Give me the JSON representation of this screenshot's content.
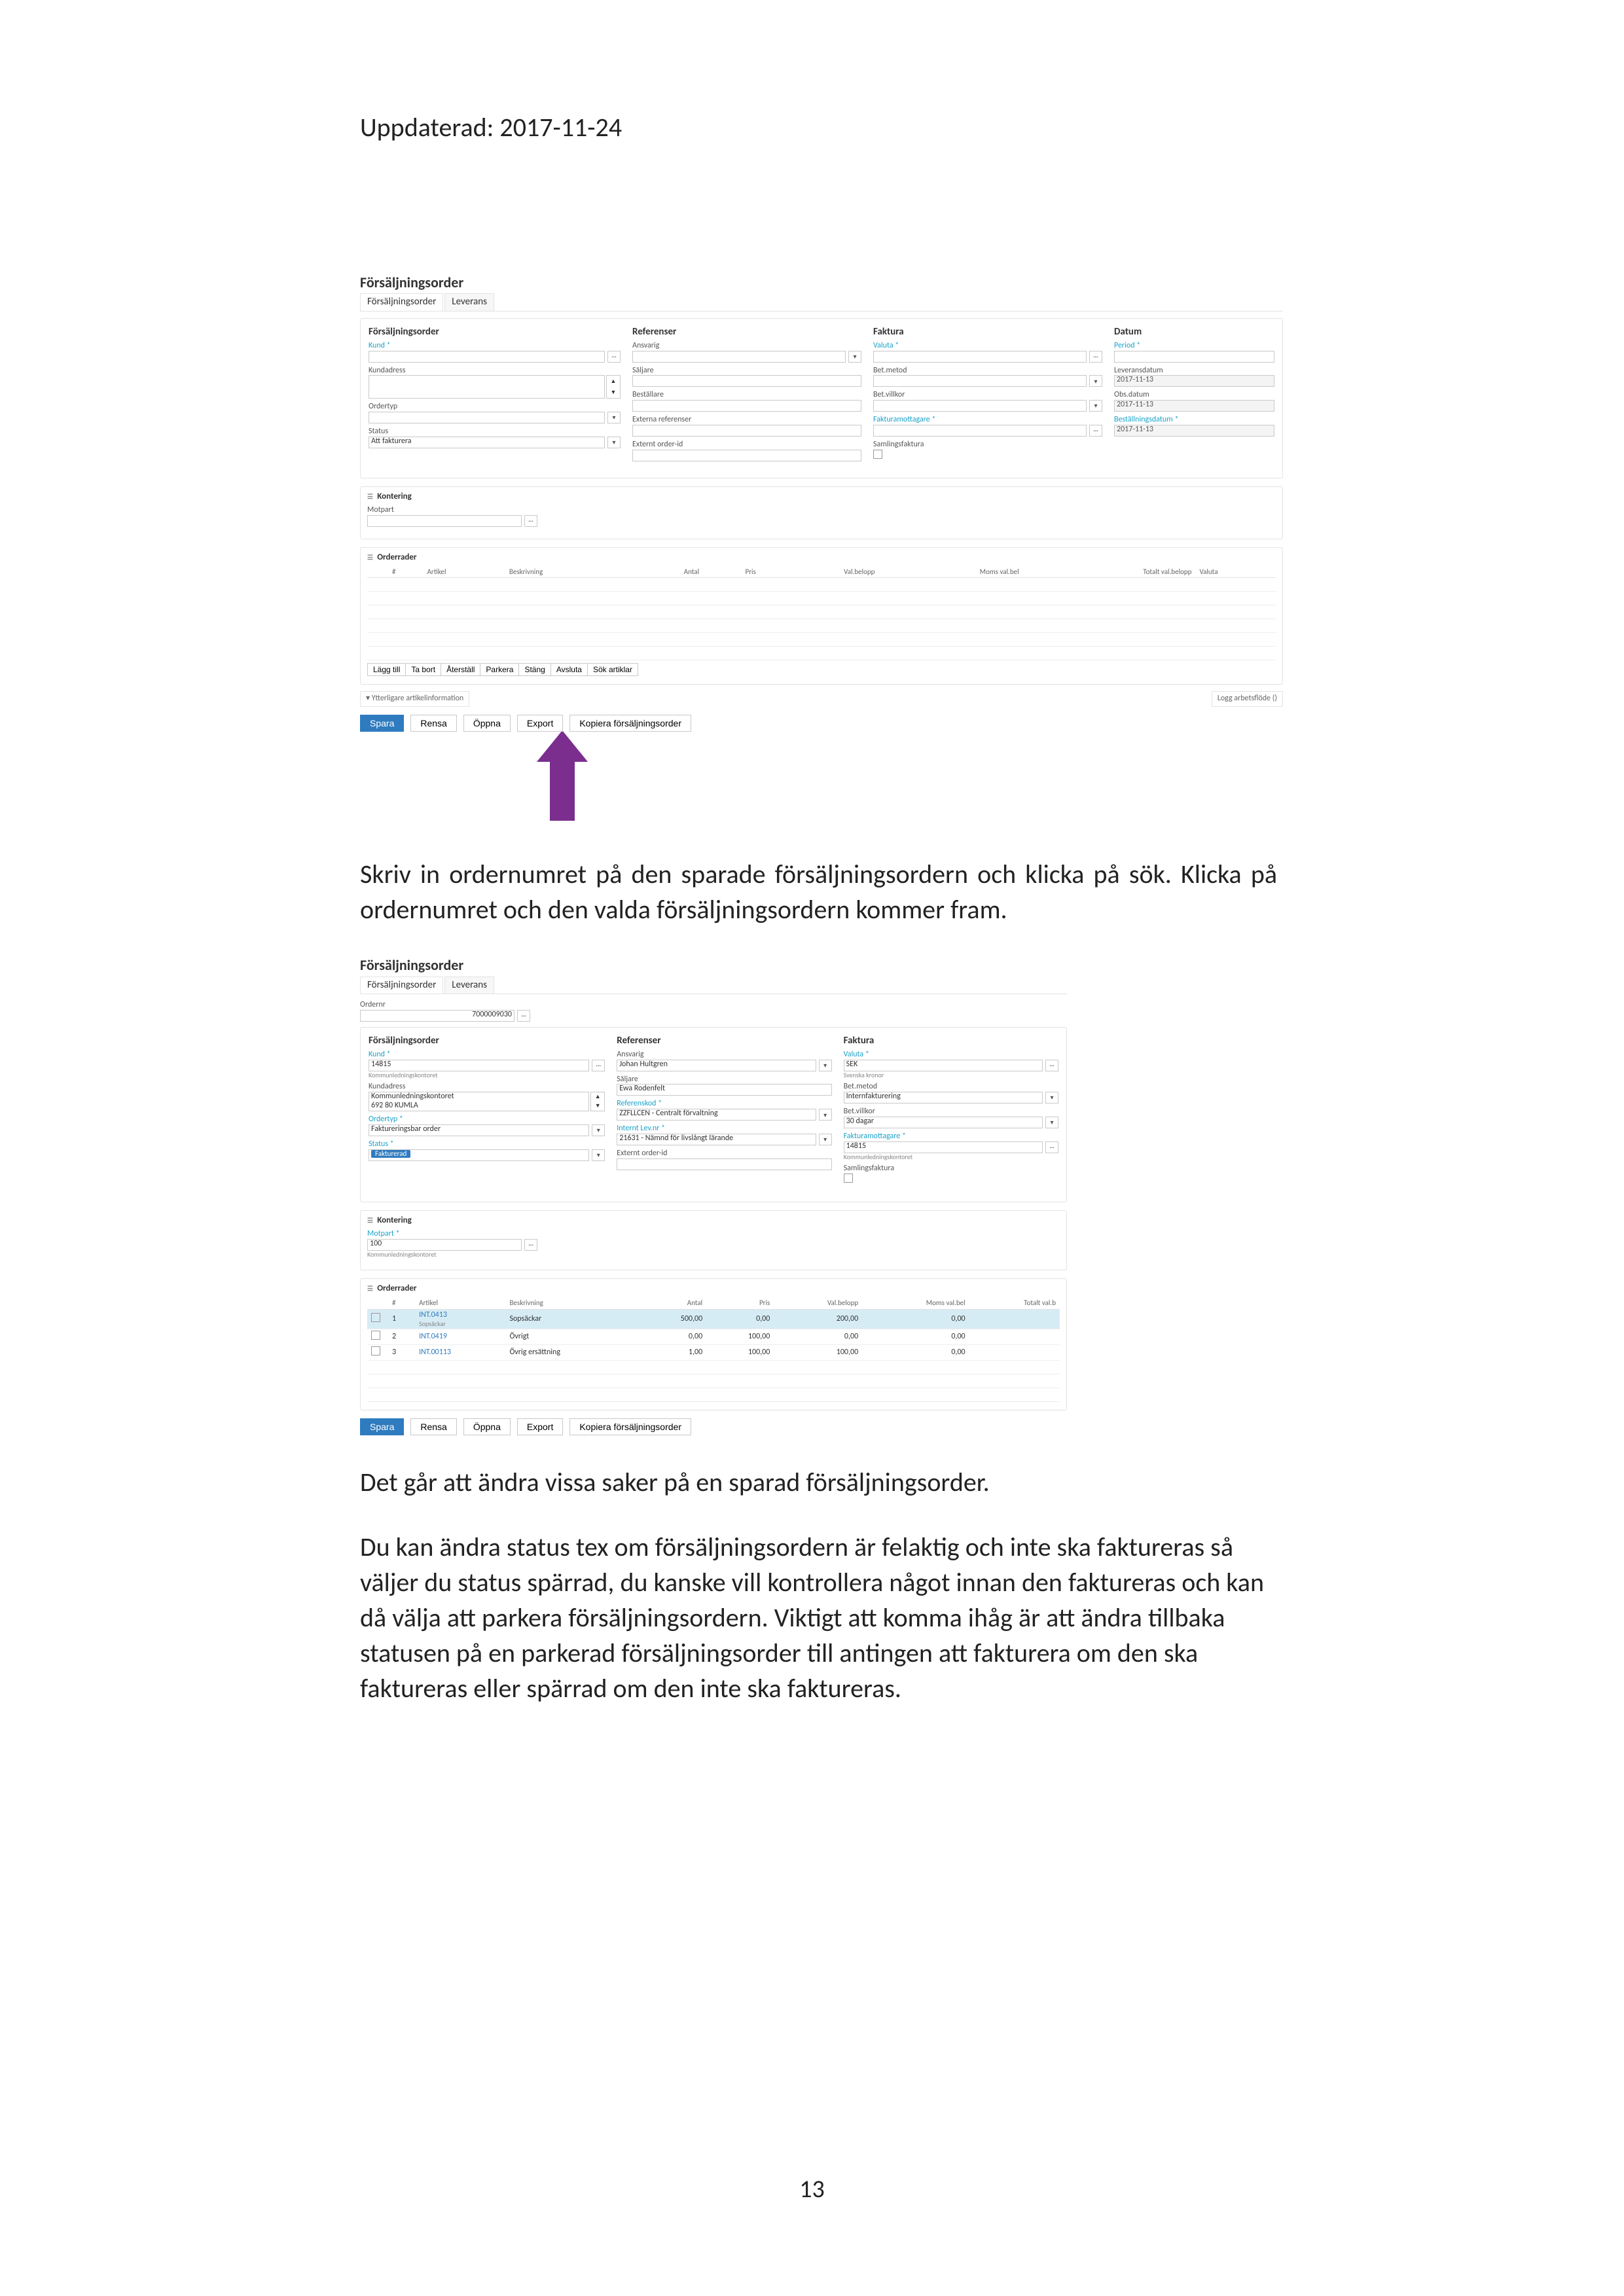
{
  "doc": {
    "header": "Uppdaterad: 2017-11-24",
    "p1": "Skriv in ordernumret på den sparade försäljningsordern och klicka på sök. Klicka på ordernumret och den valda försäljningsordern kommer fram.",
    "p2": "Det går att ändra vissa saker på en sparad försäljningsorder.",
    "p3": "Du kan ändra status tex om försäljningsordern är felaktig och inte ska faktureras så väljer du status spärrad, du kanske vill kontrollera något innan den faktureras och kan då välja att parkera försäljningsordern. Viktigt att komma ihåg är att ändra tillbaka statusen på en parkerad försäljningsorder till antingen att fakturera om den ska faktureras eller spärrad om den inte ska faktureras.",
    "page_number": "13"
  },
  "common": {
    "window_title": "Försäljningsorder",
    "tabs": {
      "a": "Försäljningsorder",
      "b": "Leverans"
    },
    "panels": {
      "a": "Försäljningsorder",
      "b": "Referenser",
      "c": "Faktura",
      "d": "Datum"
    },
    "labels": {
      "kund": "Kund *",
      "kundadress": "Kundadress",
      "ordertyp": "Ordertyp",
      "status": "Status",
      "ansvarig": "Ansvarig",
      "saljare": "Säljare",
      "bestallare": "Beställare",
      "externa_ref": "Externa referenser",
      "externt_oid": "Externt order-id",
      "valuta": "Valuta *",
      "betmetod": "Bet.metod",
      "betvillkor": "Bet.villkor",
      "fakturamott": "Fakturamottagare *",
      "samlfakt": "Samlingsfaktura",
      "period": "Period *",
      "leveransdatum": "Leveransdatum",
      "obsdatum": "Obs.datum",
      "bestallningsdatum": "Beställningsdatum *",
      "motpart": "Motpart",
      "ordernr": "Ordernr",
      "referenskod": "Referenskod *",
      "internt_lev": "Internt Lev.nr *",
      "ordertyp_req": "Ordertyp *",
      "status_req": "Status *",
      "motpart_req": "Motpart *"
    },
    "sections": {
      "kontering": "Kontering",
      "orderrader": "Orderrader",
      "ytterligare": "Ytterligare artikelinformation",
      "logg": "Logg arbetsflöde ()"
    },
    "cols": {
      "hash": "#",
      "artikel": "Artikel",
      "beskrivning": "Beskrivning",
      "antal": "Antal",
      "pris": "Pris",
      "valbelopp": "Val.belopp",
      "momsvalbel": "Moms val.bel",
      "totalt": "Totalt val.belopp",
      "valuta": "Valuta",
      "totaltb": "Totalt val.b"
    },
    "row_actions": {
      "add": "Lägg till",
      "del": "Ta bort",
      "restore": "Återställ",
      "park": "Parkera",
      "close": "Stäng",
      "cancel": "Avsluta",
      "search": "Sök artiklar"
    },
    "bottom": {
      "save": "Spara",
      "clear": "Rensa",
      "open": "Öppna",
      "export": "Export",
      "copy": "Kopiera försäljningsorder"
    }
  },
  "shot1": {
    "status_value": "Att fakturera",
    "date1": "2017-11-13",
    "date2": "2017-11-13",
    "date3": "2017-11-13"
  },
  "shot2": {
    "ordernr": "7000009030",
    "kund": "14815",
    "kund_sub": "Kommunledningskontoret",
    "kundadress": "Kommunledningskontoret",
    "kundadress2": "692 80 KUMLA",
    "ordertyp": "Faktureringsbar order",
    "status_badge": "Fakturerad",
    "ansvarig": "Johan Hultgren",
    "saljare": "Ewa Rodenfelt",
    "refkod": "ZZFLLCEN - Centralt förvaltning",
    "internt_lev": "21631 - Nämnd för livslångt lärande",
    "valuta": "SEK",
    "valuta_sub": "Svenska kronor",
    "betmetod": "Internfakturering",
    "betvillkor": "30 dagar",
    "fakturamott": "14815",
    "fakturamott_sub": "Kommunledningskontoret",
    "motpart": "100",
    "motpart_sub": "Kommunledningskontoret",
    "rows": [
      {
        "n": "1",
        "art": "INT.0413",
        "art_sub": "Sopsäckar",
        "besk": "Sopsäckar",
        "ant": "500,00",
        "pris": "0,00",
        "vb": "200,00",
        "mvb": "0,00"
      },
      {
        "n": "2",
        "art": "INT.0419",
        "besk": "Övrigt",
        "ant": "0,00",
        "pris": "100,00",
        "vb": "0,00",
        "mvb": "0,00"
      },
      {
        "n": "3",
        "art": "INT.00113",
        "besk": "Övrig ersättning",
        "ant": "1,00",
        "pris": "100,00",
        "vb": "100,00",
        "mvb": "0,00"
      }
    ]
  }
}
